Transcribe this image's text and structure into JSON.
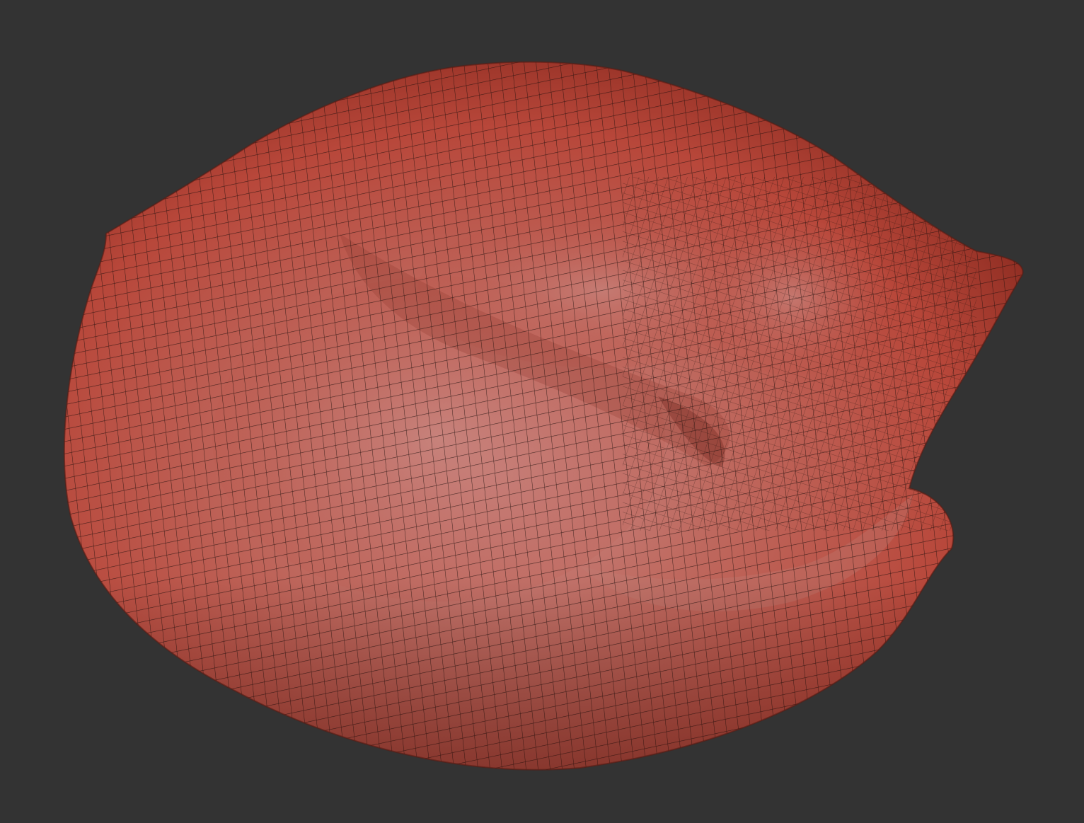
{
  "viewport": {
    "background_color": "#333333"
  },
  "model": {
    "shape_description": "sculpted-organic-blob",
    "base_color": "#b8473a",
    "highlight_color": "#c98a86",
    "shadow_color": "#8a2a1f",
    "wireframe_color": "#1e0f0c",
    "wireframe_visible": true
  }
}
